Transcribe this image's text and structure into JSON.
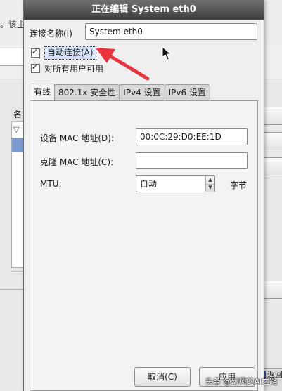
{
  "background_window": {
    "partial_text": "。该主",
    "return_label": "返回"
  },
  "dialog": {
    "title": "正在编辑 System eth0",
    "connection_name_label": "连接名称(I)",
    "connection_name_value": "System eth0",
    "auto_connect_label": "自动连接(A)",
    "auto_connect_checked": true,
    "all_users_label": "对所有用户可用",
    "all_users_checked": true,
    "tabs": [
      {
        "label": "有线",
        "active": true
      },
      {
        "label": "802.1x 安全性",
        "active": false
      },
      {
        "label": "IPv4 设置",
        "active": false
      },
      {
        "label": "IPv6 设置",
        "active": false
      }
    ],
    "wired": {
      "device_mac_label": "设备 MAC 地址(D):",
      "device_mac_value": "00:0C:29:D0:EE:1D",
      "cloned_mac_label": "克隆 MAC 地址(C):",
      "cloned_mac_value": "",
      "mtu_label": "MTU:",
      "mtu_value": "自动",
      "mtu_unit": "字节"
    },
    "buttons": {
      "cancel": "取消(C)",
      "apply": "应用"
    }
  },
  "watermark": "头条 @幻风的AI之路",
  "colors": {
    "annotation_arrow": "#e8323c",
    "titlebar": "#4a4a4a"
  }
}
